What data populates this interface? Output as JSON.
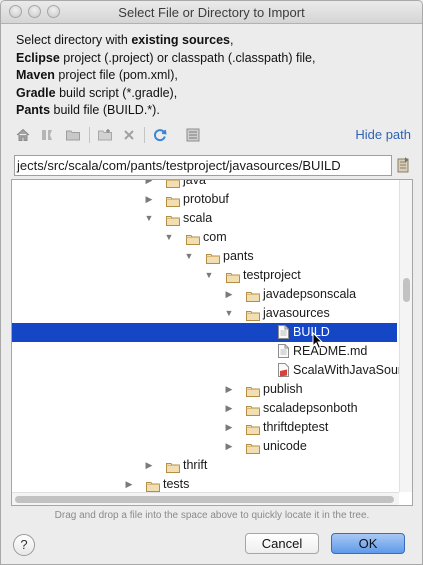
{
  "window": {
    "title": "Select File or Directory to Import"
  },
  "description": {
    "line1_prefix": "Select directory with ",
    "line1_bold": "existing sources",
    "line1_suffix": ",",
    "line2_bold": "Eclipse",
    "line2_text": " project (.project) or classpath (.classpath) file,",
    "line3_bold": "Maven",
    "line3_text": " project file (pom.xml),",
    "line4_bold": "Gradle",
    "line4_text": " build script (*.gradle),",
    "line5_bold": "Pants",
    "line5_text": " build file (BUILD.*)."
  },
  "toolbar": {
    "hide_path_label": "Hide path"
  },
  "path": {
    "value": "jects/src/scala/com/pants/testproject/javasources/BUILD"
  },
  "tree": {
    "items": [
      {
        "label": "java",
        "type": "folder",
        "arrow": "right"
      },
      {
        "label": "protobuf",
        "type": "folder",
        "arrow": "right"
      },
      {
        "label": "scala",
        "type": "folder",
        "arrow": "down"
      },
      {
        "label": "com",
        "type": "folder",
        "arrow": "down"
      },
      {
        "label": "pants",
        "type": "folder",
        "arrow": "down"
      },
      {
        "label": "testproject",
        "type": "folder",
        "arrow": "down"
      },
      {
        "label": "javadepsonscala",
        "type": "folder",
        "arrow": "right"
      },
      {
        "label": "javasources",
        "type": "folder",
        "arrow": "down"
      },
      {
        "label": "BUILD",
        "type": "file",
        "selected": true
      },
      {
        "label": "README.md",
        "type": "file"
      },
      {
        "label": "ScalaWithJavaSource",
        "type": "scala-file"
      },
      {
        "label": "publish",
        "type": "folder",
        "arrow": "right"
      },
      {
        "label": "scaladepsonboth",
        "type": "folder",
        "arrow": "right"
      },
      {
        "label": "thriftdeptest",
        "type": "folder",
        "arrow": "right"
      },
      {
        "label": "unicode",
        "type": "folder",
        "arrow": "right"
      },
      {
        "label": "thrift",
        "type": "folder",
        "arrow": "right"
      },
      {
        "label": "tests",
        "type": "folder",
        "arrow": "right"
      }
    ]
  },
  "hint": "Drag and drop a file into the space above to quickly locate it in the tree.",
  "buttons": {
    "help": "?",
    "cancel": "Cancel",
    "ok": "OK"
  },
  "colors": {
    "selection": "#1546c6",
    "link": "#2f63b5",
    "folder": "#c8a25a",
    "ok_button": "#5e9aea"
  }
}
